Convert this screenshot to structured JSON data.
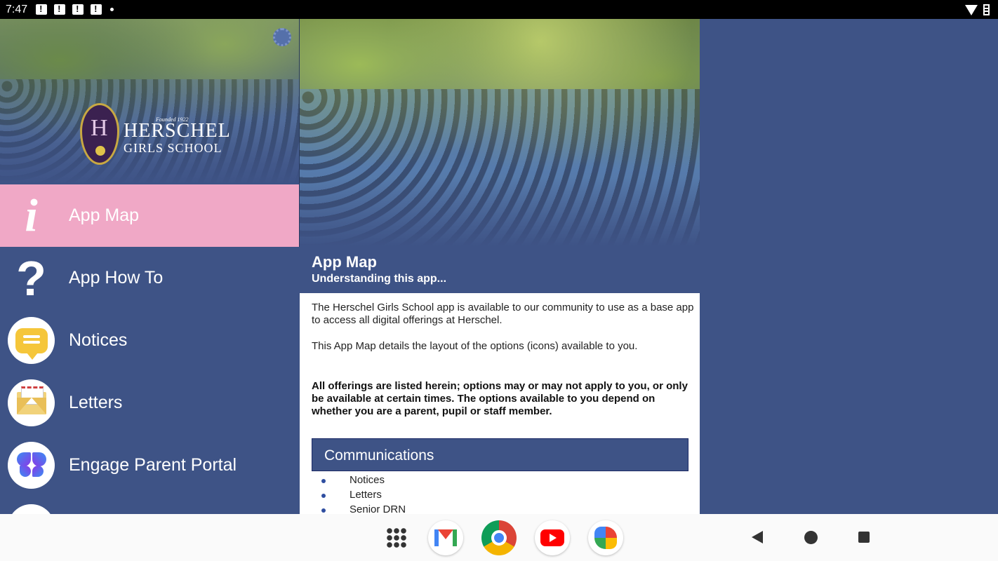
{
  "status_bar": {
    "time": "7:47"
  },
  "sidebar": {
    "school_name_line1": "HERSCHEL",
    "school_name_line2": "GIRLS SCHOOL",
    "founded": "Founded 1922",
    "items": [
      {
        "label": "App Map",
        "icon": "info-icon",
        "active": true
      },
      {
        "label": "App How To",
        "icon": "question-icon"
      },
      {
        "label": "Notices",
        "icon": "notices-icon"
      },
      {
        "label": "Letters",
        "icon": "letters-icon"
      },
      {
        "label": "Engage Parent Portal",
        "icon": "butterfly-icon"
      }
    ]
  },
  "content": {
    "title": "App Map",
    "subtitle": "Understanding this app...",
    "paragraphs": [
      "The Herschel Girls School app is available to our community to use as a base app to access all digital offerings at Herschel.",
      "This App Map details the layout of the options (icons) available to you.",
      "All offerings are listed herein; options may or may not apply to you, or only be available at certain times. The options available to you depend on whether you are a parent, pupil or staff member."
    ],
    "section_heading": "Communications",
    "section_items": [
      "Notices",
      "Letters",
      "Senior DRN"
    ]
  },
  "nav_bar": {
    "dock": [
      "apps-grid-icon",
      "gmail-icon",
      "chrome-icon",
      "youtube-icon",
      "photos-icon"
    ],
    "buttons": [
      "back-icon",
      "home-icon",
      "recents-icon"
    ]
  },
  "colors": {
    "primary": "#3e5386",
    "active_item": "#f0a8c6",
    "section_border": "#1c2a66"
  }
}
